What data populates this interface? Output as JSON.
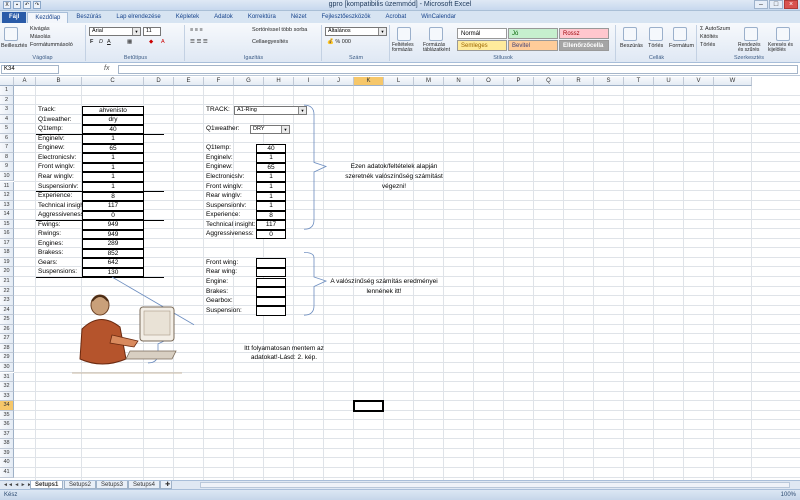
{
  "window": {
    "title": "gpro  [kompatibilis üzemmód] - Microsoft Excel",
    "minimize": "–",
    "maximize": "□",
    "close": "×"
  },
  "tabs": [
    "Fájl",
    "Kezdőlap",
    "Beszúrás",
    "Lap elrendezése",
    "Képletek",
    "Adatok",
    "Korrektúra",
    "Nézet",
    "Fejlesztőeszközök",
    "Acrobat",
    "WinCalendar"
  ],
  "ribbon": {
    "clipboard": {
      "paste": "Beillesztés",
      "cut": "Kivágás",
      "copy": "Másolás",
      "painter": "Formátummásoló",
      "label": "Vágólap"
    },
    "font": {
      "name": "Arial",
      "size": "11",
      "label": "Betűtípus"
    },
    "alignment": {
      "wrap": "Sortöréssel több sorba",
      "merge": "Cellaegyesítés",
      "label": "Igazítás"
    },
    "number": {
      "format": "Általános",
      "label": "Szám"
    },
    "styles": {
      "cond": "Feltételes formázás",
      "table": "Formázás táblázatként",
      "normal": "Normál",
      "good": "Jó",
      "bad": "Rossz",
      "neutral": "Semleges",
      "input": "Bevitel",
      "check": "Ellenőrzőcella",
      "label": "Stílusok"
    },
    "cells": {
      "insert": "Beszúrás",
      "delete": "Törlés",
      "format": "Formátum",
      "label": "Cellák"
    },
    "editing": {
      "autosum": "AutoSzum",
      "fill": "Kitöltés",
      "clear": "Törlés",
      "sort": "Rendezés és szűrés",
      "find": "Keresés és kijelölés",
      "label": "Szerkesztés"
    }
  },
  "formula_bar": {
    "name_box": "K34",
    "fx": "fx",
    "value": ""
  },
  "columns": [
    "A",
    "B",
    "C",
    "D",
    "E",
    "F",
    "G",
    "H",
    "I",
    "J",
    "K",
    "L",
    "M",
    "N",
    "O",
    "P",
    "Q",
    "R",
    "S",
    "T",
    "U",
    "V",
    "W"
  ],
  "rows": [
    "1",
    "2",
    "3",
    "4",
    "5",
    "6",
    "7",
    "8",
    "9",
    "10",
    "11",
    "12",
    "13",
    "14",
    "15",
    "16",
    "17",
    "18",
    "19",
    "20",
    "21",
    "22",
    "23",
    "24",
    "25",
    "26",
    "27",
    "28",
    "29",
    "30",
    "31",
    "32",
    "33",
    "34",
    "35",
    "36",
    "37",
    "38",
    "39",
    "40",
    "41"
  ],
  "left_table": {
    "track_label": "Track:",
    "track": "ahvenisto",
    "weather_label": "Q1weather:",
    "weather": "dry",
    "temp_label": "Q1temp:",
    "temp": "40",
    "items": [
      {
        "label": "Enginelv:",
        "value": "1"
      },
      {
        "label": "Enginew:",
        "value": "65"
      },
      {
        "label": "Electronicslv:",
        "value": "1"
      },
      {
        "label": "Front winglv:",
        "value": "1"
      },
      {
        "label": "Rear winglv:",
        "value": "1"
      },
      {
        "label": "Suspensionlv:",
        "value": "1"
      },
      {
        "label": "Experience:",
        "value": "8"
      },
      {
        "label": "Technical insight:",
        "value": "117"
      },
      {
        "label": "Aggressiveness:",
        "value": "0"
      },
      {
        "label": "Fwings:",
        "value": "949"
      },
      {
        "label": "Rwings:",
        "value": "949"
      },
      {
        "label": "Engines:",
        "value": "289"
      },
      {
        "label": "Brakess:",
        "value": "852"
      },
      {
        "label": "Gears:",
        "value": "642"
      },
      {
        "label": "Suspensions:",
        "value": "130"
      }
    ]
  },
  "right_inputs": {
    "track_label": "TRACK:",
    "track": "A1-Ring",
    "weather_label": "Q1weather:",
    "weather": "DRY",
    "items": [
      {
        "label": "Q1temp:",
        "value": "40"
      },
      {
        "label": "Enginelv:",
        "value": "1"
      },
      {
        "label": "Enginew:",
        "value": "65"
      },
      {
        "label": "Electronicslv:",
        "value": "1"
      },
      {
        "label": "Front winglv:",
        "value": "1"
      },
      {
        "label": "Rear winglv:",
        "value": "1"
      },
      {
        "label": "Suspensionlv:",
        "value": "1"
      },
      {
        "label": "Experience:",
        "value": "8"
      },
      {
        "label": "Technical insight:",
        "value": "117"
      },
      {
        "label": "Aggressiveness:",
        "value": "0"
      }
    ]
  },
  "results": {
    "items": [
      {
        "label": "Front wing:"
      },
      {
        "label": "Rear wing:"
      },
      {
        "label": "Engine:"
      },
      {
        "label": "Brakes:"
      },
      {
        "label": "Gearbox:"
      },
      {
        "label": "Suspension:"
      }
    ]
  },
  "notes": {
    "note1": [
      "Ezen adatok/feltételek alapján",
      "szeretnék valószínűség számítást",
      "végezni!"
    ],
    "note2": [
      "A valószínűség számítás eredményei",
      "lennének itt!"
    ],
    "note3": [
      "Itt folyamatosan mentem az",
      "adatokat!-Lásd: 2. kép."
    ]
  },
  "sheets": [
    "Setups1",
    "Setups2",
    "Setups3",
    "Setups4"
  ],
  "status": {
    "ready": "Kész",
    "zoom": "100%"
  }
}
